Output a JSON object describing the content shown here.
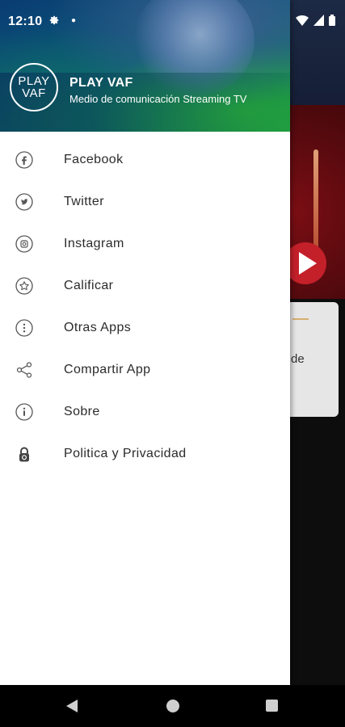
{
  "status_bar": {
    "time": "12:10",
    "icons": [
      "settings-icon",
      "notification-dot-icon",
      "wifi-icon",
      "signal-icon",
      "battery-icon"
    ]
  },
  "drawer": {
    "logo": {
      "line1": "PLAY",
      "line2": "VAF"
    },
    "title": "PLAY VAF",
    "subtitle": "Medio de comunicación Streaming TV",
    "items": [
      {
        "label": "Facebook",
        "icon": "facebook-icon"
      },
      {
        "label": "Twitter",
        "icon": "twitter-icon"
      },
      {
        "label": "Instagram",
        "icon": "instagram-icon"
      },
      {
        "label": "Calificar",
        "icon": "star-icon"
      },
      {
        "label": "Otras Apps",
        "icon": "more-vertical-icon"
      },
      {
        "label": "Compartir App",
        "icon": "share-icon"
      },
      {
        "label": "Sobre",
        "icon": "info-icon"
      },
      {
        "label": "Politica y Privacidad",
        "icon": "lock-icon"
      }
    ]
  },
  "background": {
    "card_text": "de"
  },
  "colors": {
    "icon_gray": "#555555",
    "label": "#2b2b2b",
    "accent_red": "#c4202a"
  }
}
